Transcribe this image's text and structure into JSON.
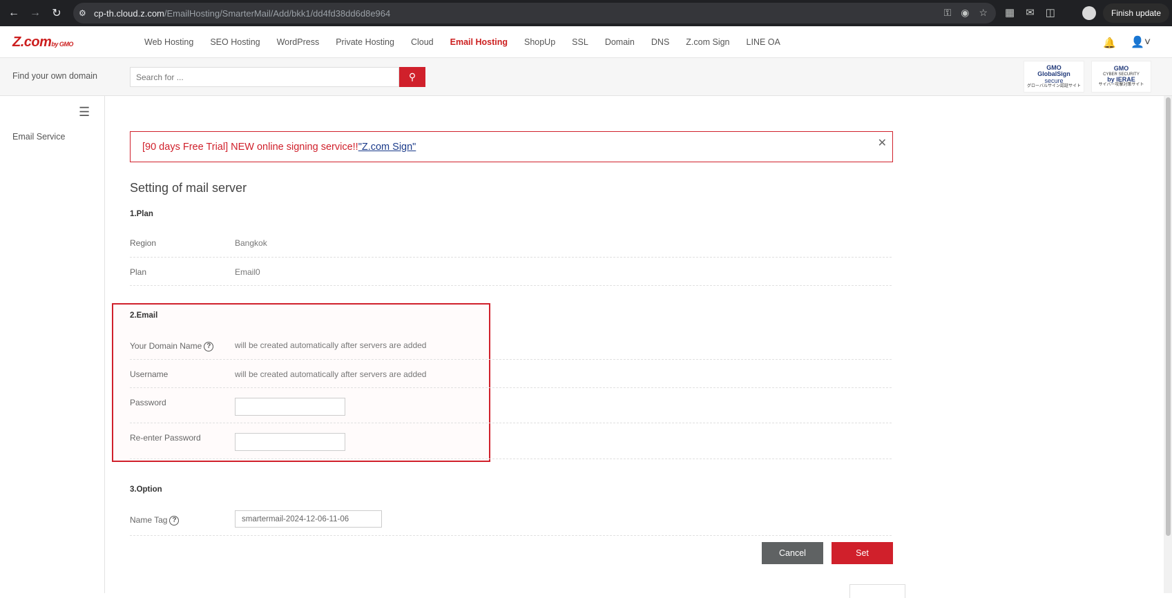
{
  "browser": {
    "url_host": "cp-th.cloud.z.com",
    "url_path": "/EmailHosting/SmarterMail/Add/bkk1/dd4fd38dd6d8e964",
    "finish_update": "Finish update",
    "icons": [
      "back-arrow-icon",
      "forward-arrow-icon",
      "reload-icon",
      "site-settings-icon",
      "key-icon",
      "eye-off-icon",
      "star-icon",
      "translate-icon",
      "extension-icon",
      "puzzle-icon",
      "profile-icon"
    ]
  },
  "header": {
    "logo_text": "Z.com",
    "logo_sub": "by GMO",
    "menu": [
      {
        "label": "Web Hosting",
        "active": false
      },
      {
        "label": "SEO Hosting",
        "active": false
      },
      {
        "label": "WordPress",
        "active": false
      },
      {
        "label": "Private Hosting",
        "active": false
      },
      {
        "label": "Cloud",
        "active": false
      },
      {
        "label": "Email Hosting",
        "active": true
      },
      {
        "label": "ShopUp",
        "active": false
      },
      {
        "label": "SSL",
        "active": false
      },
      {
        "label": "Domain",
        "active": false
      },
      {
        "label": "DNS",
        "active": false
      },
      {
        "label": "Z.com Sign",
        "active": false
      },
      {
        "label": "LINE OA",
        "active": false
      }
    ]
  },
  "search": {
    "label": "Find your own domain",
    "placeholder": "Search for ..."
  },
  "badges": {
    "badge1_top": "GMO",
    "badge1_mid": "GlobalSign",
    "badge1_bot": "secure",
    "badge1_small": "グローバルサイン認証サイト",
    "badge2_top": "GMO",
    "badge2_mid": "CYBER SECURITY",
    "badge2_bot": "by IERAE",
    "badge2_small": "サイバー攻撃対策サイト"
  },
  "sidebar": {
    "items": [
      {
        "label": "Email Service"
      }
    ]
  },
  "banner": {
    "text": "[90 days Free Trial] NEW online signing service!! ",
    "link": "\"Z.com Sign\"",
    "close": "✕"
  },
  "page": {
    "title": "Setting of mail server",
    "section_plan": "1.Plan",
    "region_label": "Region",
    "region_value": "Bangkok",
    "plan_label": "Plan",
    "plan_value": "Email0",
    "section_email": "2.Email",
    "domain_label": "Your Domain Name",
    "domain_value": "will be created automatically after servers are added",
    "username_label": "Username",
    "username_value": "will be created automatically after servers are added",
    "password_label": "Password",
    "password_value": "",
    "repassword_label": "Re-enter Password",
    "repassword_value": "",
    "section_option": "3.Option",
    "nametag_label": "Name Tag",
    "nametag_value": "smartermail-2024-12-06-11-06",
    "help_glyph": "?"
  },
  "buttons": {
    "cancel": "Cancel",
    "set": "Set"
  },
  "colors": {
    "brand_red": "#d0202b",
    "cancel_gray": "#5f6263"
  }
}
